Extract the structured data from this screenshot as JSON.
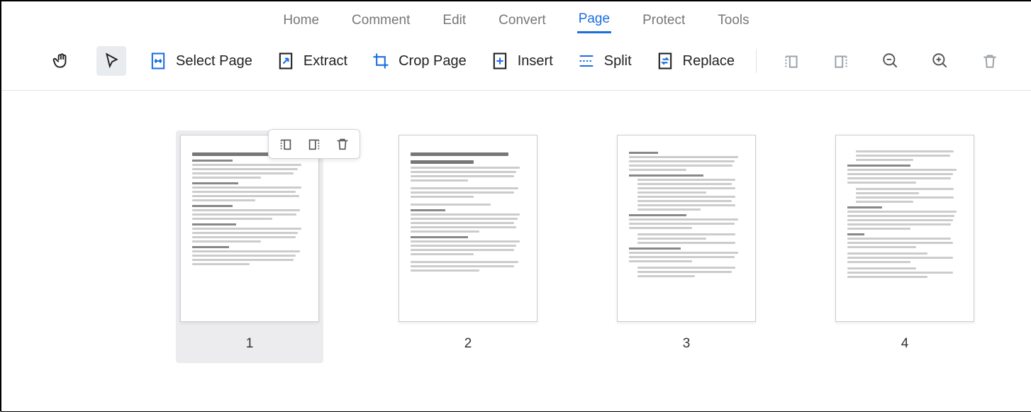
{
  "tabs": {
    "home": "Home",
    "comment": "Comment",
    "edit": "Edit",
    "convert": "Convert",
    "page": "Page",
    "protect": "Protect",
    "tools": "Tools",
    "active": "page"
  },
  "toolbar": {
    "select_page": "Select Page",
    "extract": "Extract",
    "crop_page": "Crop Page",
    "insert": "Insert",
    "split": "Split",
    "replace": "Replace"
  },
  "pages": [
    "1",
    "2",
    "3",
    "4"
  ],
  "selected_page_index": 0
}
